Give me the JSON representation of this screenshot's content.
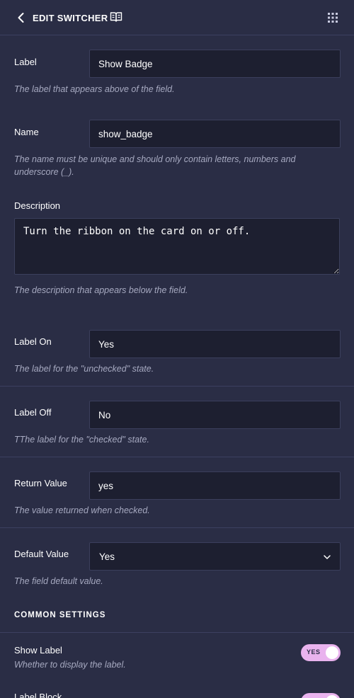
{
  "header": {
    "title": "EDIT SWITCHER"
  },
  "fields": {
    "label": {
      "label": "Label",
      "value": "Show Badge",
      "help": "The label that appears above of the field."
    },
    "name": {
      "label": "Name",
      "value": "show_badge",
      "help": "The name must be unique and should only contain letters, numbers and underscore (_)."
    },
    "description": {
      "label": "Description",
      "value": "Turn the ribbon on the card on or off.",
      "help": "The description that appears below the field."
    },
    "label_on": {
      "label": "Label On",
      "value": "Yes",
      "help": "The label for the \"unchecked\" state."
    },
    "label_off": {
      "label": "Label Off",
      "value": "No",
      "help": "TThe label for the \"checked\" state."
    },
    "return_value": {
      "label": "Return Value",
      "value": "yes",
      "help": "The value returned when checked."
    },
    "default_value": {
      "label": "Default Value",
      "value": "Yes",
      "help": "The field default value."
    }
  },
  "common_settings": {
    "title": "COMMON SETTINGS",
    "show_label": {
      "label": "Show Label",
      "help": "Whether to display the label.",
      "toggle_text": "YES",
      "checked": true
    },
    "label_block": {
      "label": "Label Block"
    }
  },
  "colors": {
    "background": "#2a2d45",
    "input_bg": "#1d1f30",
    "toggle_on": "#e9b3ee",
    "help_text": "#a6a9c0"
  }
}
